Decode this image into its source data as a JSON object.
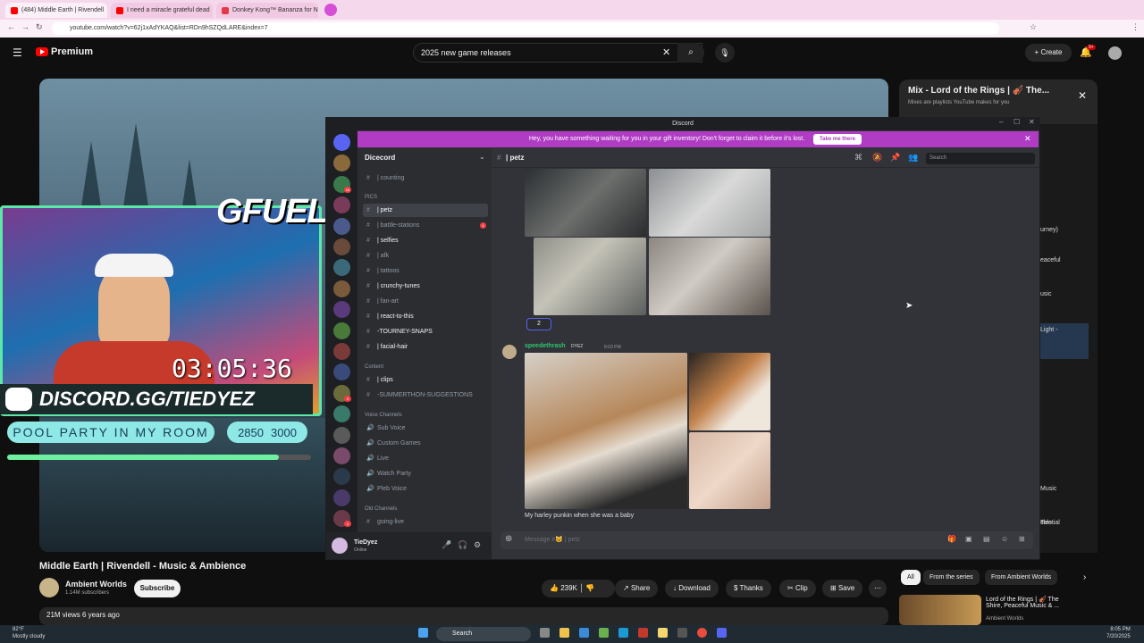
{
  "browser": {
    "tabs": [
      {
        "label": "(484) Middle Earth | Rivendell",
        "color": "#ff0000"
      },
      {
        "label": "I need a miracle grateful dead",
        "color": "#ff0000"
      },
      {
        "label": "Donkey Kong™ Bananza for Ni",
        "color": "#e63946"
      }
    ],
    "url": "youtube.com/watch?v=62j1xAdYKAQ&list=RDn9hSZQdLARE&index=7"
  },
  "youtube": {
    "brand": "Premium",
    "search_value": "2025 new game releases",
    "create_label": "Create",
    "notif_count": "9+",
    "video_title": "Middle Earth | Rivendell - Music & Ambience",
    "channel_name": "Ambient Worlds",
    "channel_subs": "1.14M subscribers",
    "subscribe_label": "Subscribe",
    "likes": "239K",
    "actions": {
      "share": "Share",
      "download": "Download",
      "thanks": "Thanks",
      "clip": "Clip",
      "save": "Save"
    },
    "views": "21M views  6 years ago",
    "mix_title": "Mix - Lord of the Rings | 🎻 The...",
    "mix_sub": "Mixes are playlists YouTube makes for you",
    "sidebar_snips": [
      "urney)",
      "eaceful",
      "usic",
      "Light -",
      "Music",
      "elestial",
      "Tale"
    ],
    "chips": [
      "All",
      "From the series",
      "From Ambient Worlds"
    ],
    "reco_title": "Lord of the Rings | 🎻 The Shire, Peaceful Music & ...",
    "reco_channel": "Ambient Worlds"
  },
  "stream": {
    "sponsor": "GFUEL",
    "timer": "03:05:36",
    "discord_link": "DISCORD.GG/TIEDYEZ",
    "goal_label": "POOL PARTY IN MY ROOM",
    "goal_current": "2850",
    "goal_target": "3000",
    "goal_progress": 0.95
  },
  "discord": {
    "window_title": "Discord",
    "banner_text": "Hey, you have something waiting for you in your gift inventory! Don't forget to claim it before it's lost.",
    "banner_button": "Take me there",
    "server_name": "Dicecord",
    "categories": {
      "pics": "PICS",
      "content": "Content",
      "voice": "Voice Channels",
      "old": "Old Channels"
    },
    "channels_top": [
      {
        "name": "| counting"
      }
    ],
    "channels_pics": [
      {
        "name": "| petz",
        "active": true
      },
      {
        "name": "| battle-stations",
        "badge": "1"
      },
      {
        "name": "| selfies",
        "bold": true
      },
      {
        "name": "| afk"
      },
      {
        "name": "| tattoos"
      },
      {
        "name": "| crunchy-tunes",
        "bold": true
      },
      {
        "name": "| fan-art"
      },
      {
        "name": "| react-to-this",
        "bold": true
      },
      {
        "name": "-TOURNEY-SNAPS",
        "bold": true
      },
      {
        "name": "| facial-hair",
        "bold": true
      }
    ],
    "channels_content": [
      {
        "name": "| clips",
        "bold": true
      },
      {
        "name": "-SUMMERTHON-SUGGESTIONS"
      }
    ],
    "voice_channels": [
      "Sub Voice",
      "Custom Games",
      "Live",
      "Watch Party",
      "Pleb Voice"
    ],
    "old_channels": [
      "going-live"
    ],
    "current_channel": "| petz",
    "search_placeholder": "Search",
    "reaction_count": "2",
    "message_author": "speedethrash",
    "message_tag": "DYEZ",
    "message_time": "8:03 PM",
    "message_text": "My harley punkin when she was a baby",
    "input_placeholder": "Message #🐱 | petz",
    "user_name": "TieDyez",
    "user_status": "Online",
    "server_badges": [
      "",
      "",
      "16",
      "",
      "",
      "",
      "",
      "",
      "",
      "",
      "",
      "",
      "3",
      "",
      "",
      "",
      "",
      "",
      "2",
      "",
      "",
      "NEW"
    ]
  },
  "taskbar": {
    "weather_temp": "82°F",
    "weather_desc": "Mostly cloudy",
    "search_label": "Search",
    "time": "8:05 PM",
    "date": "7/20/2025"
  }
}
